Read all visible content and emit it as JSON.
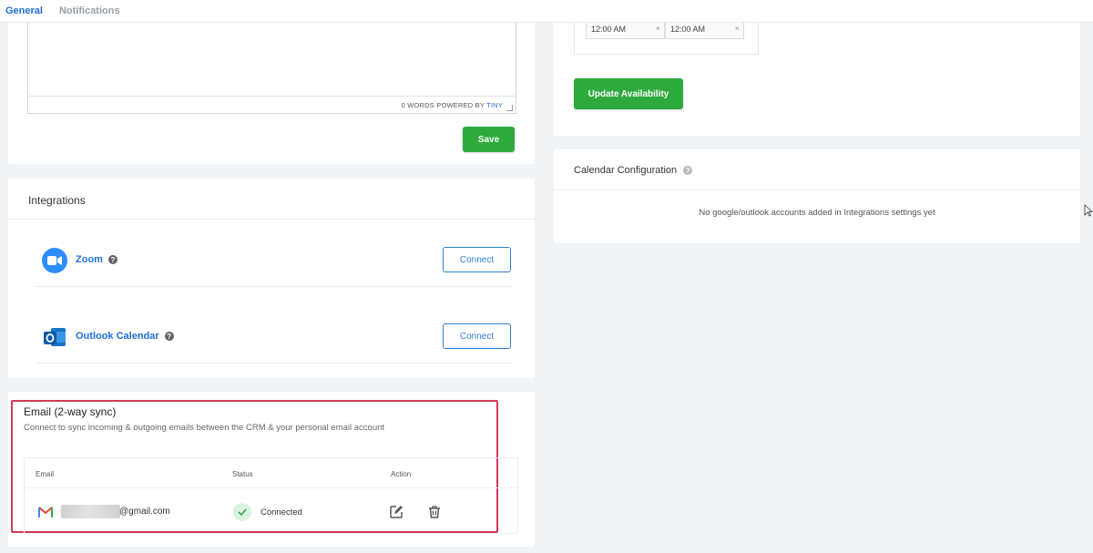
{
  "tabs": [
    {
      "label": "General",
      "active": true
    },
    {
      "label": "Notifications",
      "active": false
    }
  ],
  "editor": {
    "status_prefix": "0 WORDS POWERED BY ",
    "status_brand": "TINY",
    "save_label": "Save"
  },
  "integrations": {
    "title": "Integrations",
    "items": [
      {
        "name": "Zoom",
        "icon": "zoom-icon",
        "button_label": "Connect"
      },
      {
        "name": "Outlook Calendar",
        "icon": "outlook-icon",
        "button_label": "Connect"
      }
    ],
    "help_glyph": "?"
  },
  "email_sync": {
    "title": "Email (2-way sync)",
    "subtitle": "Connect to sync incoming & outgoing emails between the CRM & your personal email account",
    "columns": [
      "Email",
      "Status",
      "Action"
    ],
    "rows": [
      {
        "email_domain": "@gmail.com",
        "status": "Connected"
      }
    ]
  },
  "availability": {
    "time_start": "12:00 AM",
    "time_end": "12:00 AM",
    "clear_glyph": "×",
    "update_label": "Update Availability"
  },
  "calendar_config": {
    "title": "Calendar Configuration",
    "message": "No google/outlook accounts added in Integrations settings yet"
  },
  "colors": {
    "accent_blue": "#1f6fd6",
    "green": "#2eaa3d",
    "highlight_red": "#d23a57"
  }
}
